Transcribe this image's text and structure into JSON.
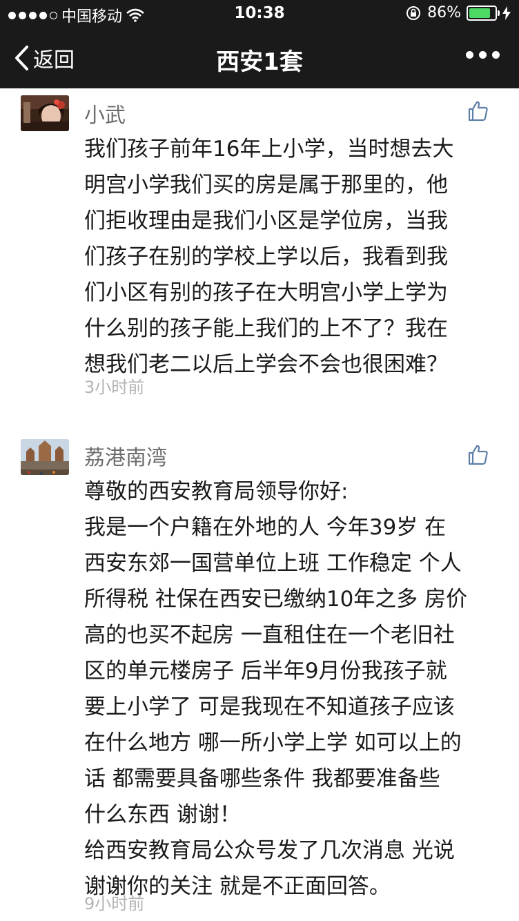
{
  "status_bar": {
    "carrier": "中国移动",
    "time": "10:38",
    "battery_percent": "86%",
    "battery_level": 0.86,
    "signal_icon": "signal-dots-icon",
    "wifi_icon": "wifi-icon",
    "lock_icon": "rotation-lock-icon",
    "charging_icon": "charging-bolt-icon"
  },
  "nav": {
    "back_label": "返回",
    "title": "西安1套",
    "more_icon": "more-dots-icon"
  },
  "comments": [
    {
      "name": "小武",
      "lines": [
        "我们孩子前年16年上小学，当时想去大",
        "明宫小学我们买的房是属于那里的，他",
        "们拒收理由是我们小区是学位房，当我",
        "们孩子在别的学校上学以后，我看到我",
        "们小区有别的孩子在大明宫小学上学为",
        "什么别的孩子能上我们的上不了？我在",
        "想我们老二以后上学会不会也很困难？"
      ],
      "time": "3小时前"
    },
    {
      "name": "荔港南湾",
      "lines": [
        "尊敬的西安教育局领导你好:",
        "我是一个户籍在外地的人 今年39岁 在",
        "西安东郊一国营单位上班 工作稳定 个人",
        "所得税 社保在西安已缴纳10年之多 房价",
        "高的也买不起房 一直租住在一个老旧社",
        "区的单元楼房子 后半年9月份我孩子就",
        "要上小学了 可是我现在不知道孩子应该",
        "在什么地方 哪一所小学上学 如可以上的",
        "话 都需要具备哪些条件 我都要准备些",
        "什么东西 谢谢！",
        "给西安教育局公众号发了几次消息 光说",
        "谢谢你的关注 就是不正面回答。"
      ],
      "time": "9小时前"
    }
  ]
}
